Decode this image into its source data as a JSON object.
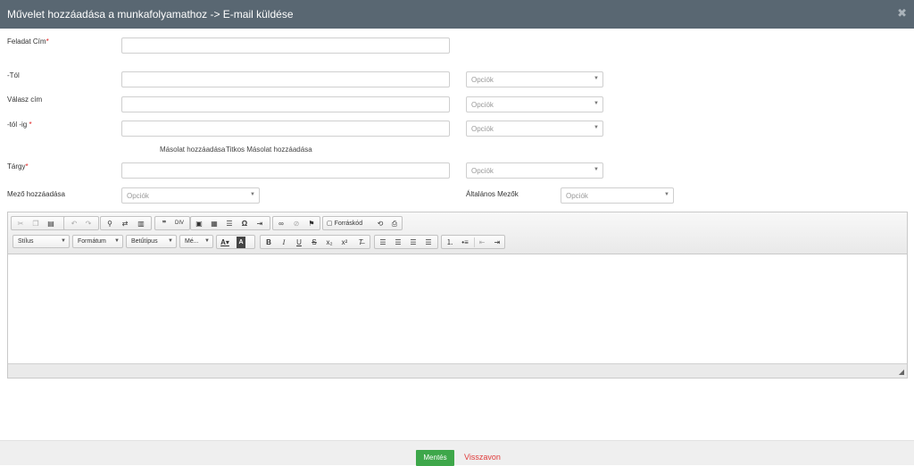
{
  "header": {
    "title": "Művelet hozzáadása a munkafolyamathoz -> E-mail küldése",
    "close_icon": "close-icon",
    "background": "#596772"
  },
  "form": {
    "task_name": {
      "label": "Feladat Cím",
      "required_mark": "*",
      "value": ""
    },
    "from": {
      "label": "-Tól",
      "value": "",
      "options_placeholder": "Opciók"
    },
    "reply_to": {
      "label": "Válasz cím",
      "value": "",
      "options_placeholder": "Opciók"
    },
    "to": {
      "label": "-tól -ig",
      "required_mark": "*",
      "value": "",
      "options_placeholder": "Opciók"
    },
    "cc_links": {
      "cc": "Másolat hozzáadása",
      "bcc": "Titkos Másolat hozzáadása"
    },
    "subject": {
      "label": "Tárgy",
      "required_mark": "*",
      "value": "",
      "options_placeholder": "Opciók"
    },
    "add_field": {
      "label": "Mező hozzáadása",
      "options_placeholder": "Opciók"
    },
    "general_fields": {
      "label": "Általános Mezők",
      "options_placeholder": "Opciók"
    }
  },
  "editor": {
    "source_label": "Forráskód",
    "combos": {
      "style": "Stílus",
      "format": "Formátum",
      "font": "Betűtípus",
      "size": "Mé..."
    },
    "icons": {
      "cut": "cut-icon",
      "copy": "copy-icon",
      "paste": "paste-icon",
      "undo": "undo-icon",
      "redo": "redo-icon",
      "find": "find-icon",
      "replace": "replace-icon",
      "spellcheck": "spellcheck-icon",
      "blockquote": "blockquote-icon",
      "div": "div-icon",
      "image": "image-icon",
      "table": "table-icon",
      "hr": "horizontal-line-icon",
      "special_char": "special-char-icon",
      "page_break": "page-break-icon",
      "link": "link-icon",
      "unlink": "unlink-icon",
      "anchor": "anchor-icon",
      "source": "source-icon",
      "templates": "templates-icon",
      "preview": "preview-icon",
      "text_color": "text-color-icon",
      "bg_color": "background-color-icon",
      "bold": "bold-icon",
      "italic": "italic-icon",
      "underline": "underline-icon",
      "strike": "strikethrough-icon",
      "subscript": "subscript-icon",
      "superscript": "superscript-icon",
      "remove_format": "remove-format-icon",
      "align_left": "align-left-icon",
      "align_center": "align-center-icon",
      "align_right": "align-right-icon",
      "justify": "justify-icon",
      "numbered_list": "numbered-list-icon",
      "bullet_list": "bullet-list-icon",
      "outdent": "outdent-icon",
      "indent": "indent-icon",
      "resize": "resize-grip-icon"
    },
    "content": ""
  },
  "footer": {
    "save_label": "Mentés",
    "cancel_label": "Visszavon",
    "save_color": "#3ea74a",
    "cancel_color": "#e03a3a"
  }
}
